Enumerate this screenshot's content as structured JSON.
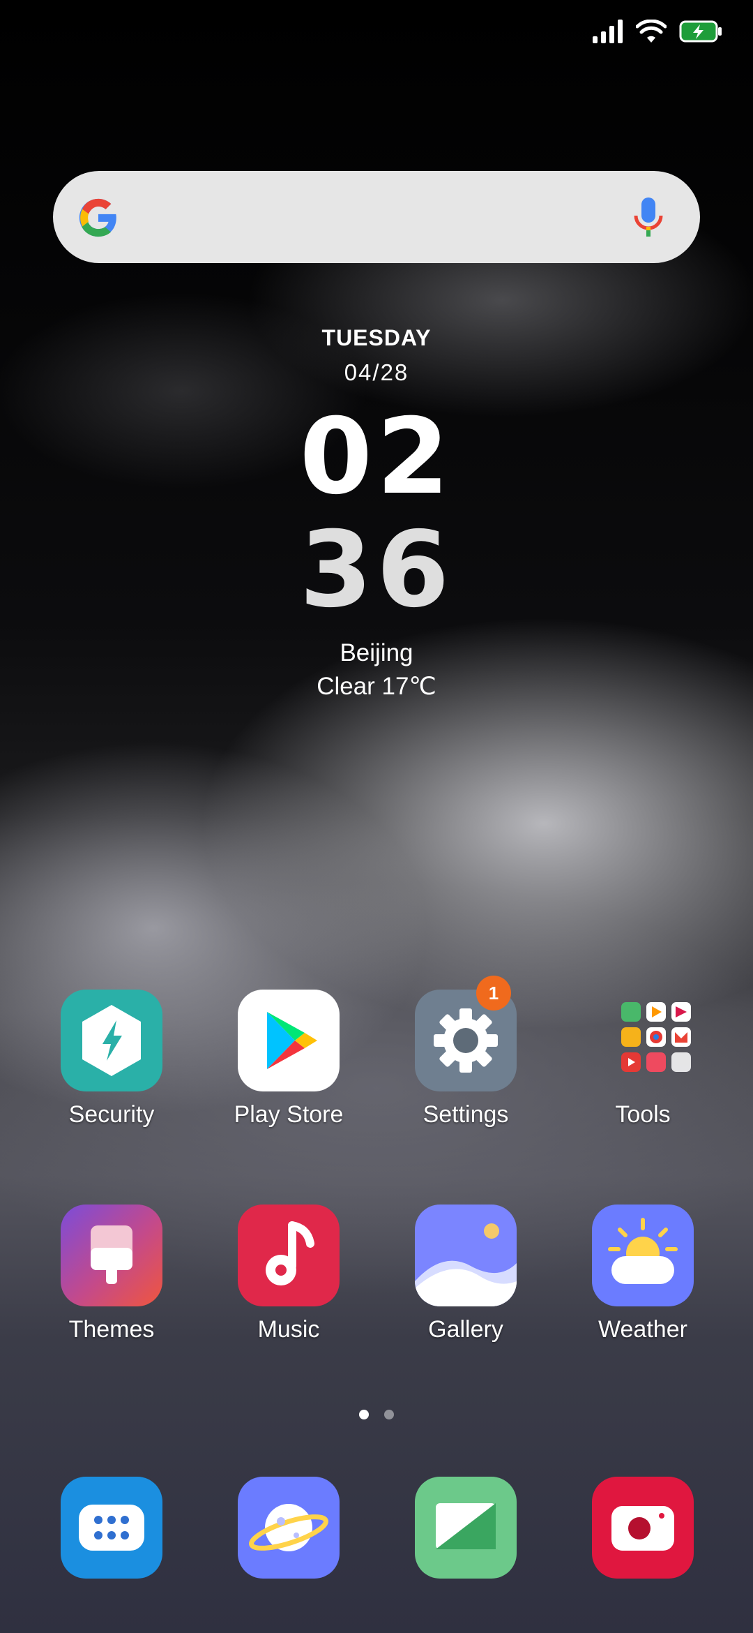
{
  "widget": {
    "day": "TUESDAY",
    "date": "04/28",
    "hour": "02",
    "minute": "36",
    "city": "Beijing",
    "weather": "Clear  17℃"
  },
  "apps": {
    "security": {
      "label": "Security"
    },
    "play_store": {
      "label": "Play Store"
    },
    "settings": {
      "label": "Settings",
      "badge": "1"
    },
    "tools": {
      "label": "Tools"
    },
    "themes": {
      "label": "Themes"
    },
    "music": {
      "label": "Music"
    },
    "gallery": {
      "label": "Gallery"
    },
    "weather": {
      "label": "Weather"
    }
  },
  "page_indicator": {
    "pages": 2,
    "current": 1
  },
  "dock": [
    "phone-dialer-icon",
    "browser-icon",
    "messages-icon",
    "camera-icon"
  ],
  "colors": {
    "security": "#2ab0a8",
    "settings": "#6f7f90",
    "music": "#e0284a",
    "gallery": "#7b85ff",
    "weather": "#6b7cff",
    "badge": "#f06a1d"
  }
}
